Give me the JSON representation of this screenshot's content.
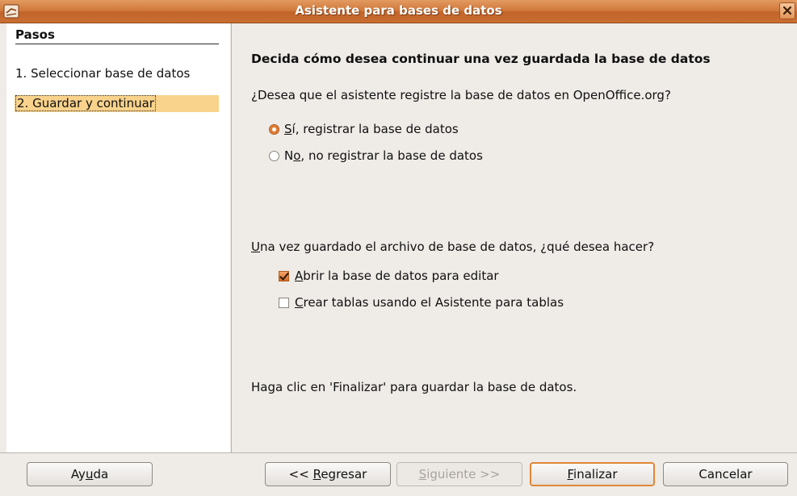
{
  "window": {
    "title": "Asistente para bases de datos",
    "accent_color": "#d1783a"
  },
  "steps": {
    "title": "Pasos",
    "items": [
      {
        "label": "1. Seleccionar base de datos",
        "active": false
      },
      {
        "label": "2. Guardar y continuar",
        "active": true
      }
    ]
  },
  "main": {
    "heading": "Decida cómo desea continuar una vez guardada la base de datos",
    "register_question": "¿Desea que el asistente registre la base de datos en OpenOffice.org?",
    "register_yes": {
      "label_pre": "",
      "label_u": "S",
      "label_post": "í, registrar la base de datos",
      "checked": true
    },
    "register_no": {
      "label_pre": "N",
      "label_u": "o",
      "label_post": ", no registrar la base de datos",
      "checked": false
    },
    "after_question": {
      "label_u": "U",
      "label_post": "na vez guardado el archivo de base de datos, ¿qué desea hacer?"
    },
    "open_edit": {
      "label_u": "A",
      "label_post": "brir la base de datos para editar",
      "checked": true
    },
    "create_tables": {
      "label_u": "C",
      "label_post": "rear tablas usando el Asistente para tablas",
      "checked": false
    },
    "finish_note": "Haga clic en 'Finalizar' para guardar la base de datos."
  },
  "buttons": {
    "help": {
      "pre": "Ay",
      "u": "u",
      "post": "da"
    },
    "back": {
      "pre": "<< ",
      "u": "R",
      "post": "egresar"
    },
    "next": {
      "pre": "",
      "u": "S",
      "post": "iguiente >>",
      "enabled": false
    },
    "finish": {
      "pre": "",
      "u": "F",
      "post": "inalizar"
    },
    "cancel": {
      "label": "Cancelar"
    }
  },
  "icons": [
    "app-icon",
    "close-icon",
    "radio-checked-icon",
    "radio-unchecked-icon",
    "checkbox-checked-icon",
    "checkbox-unchecked-icon"
  ]
}
